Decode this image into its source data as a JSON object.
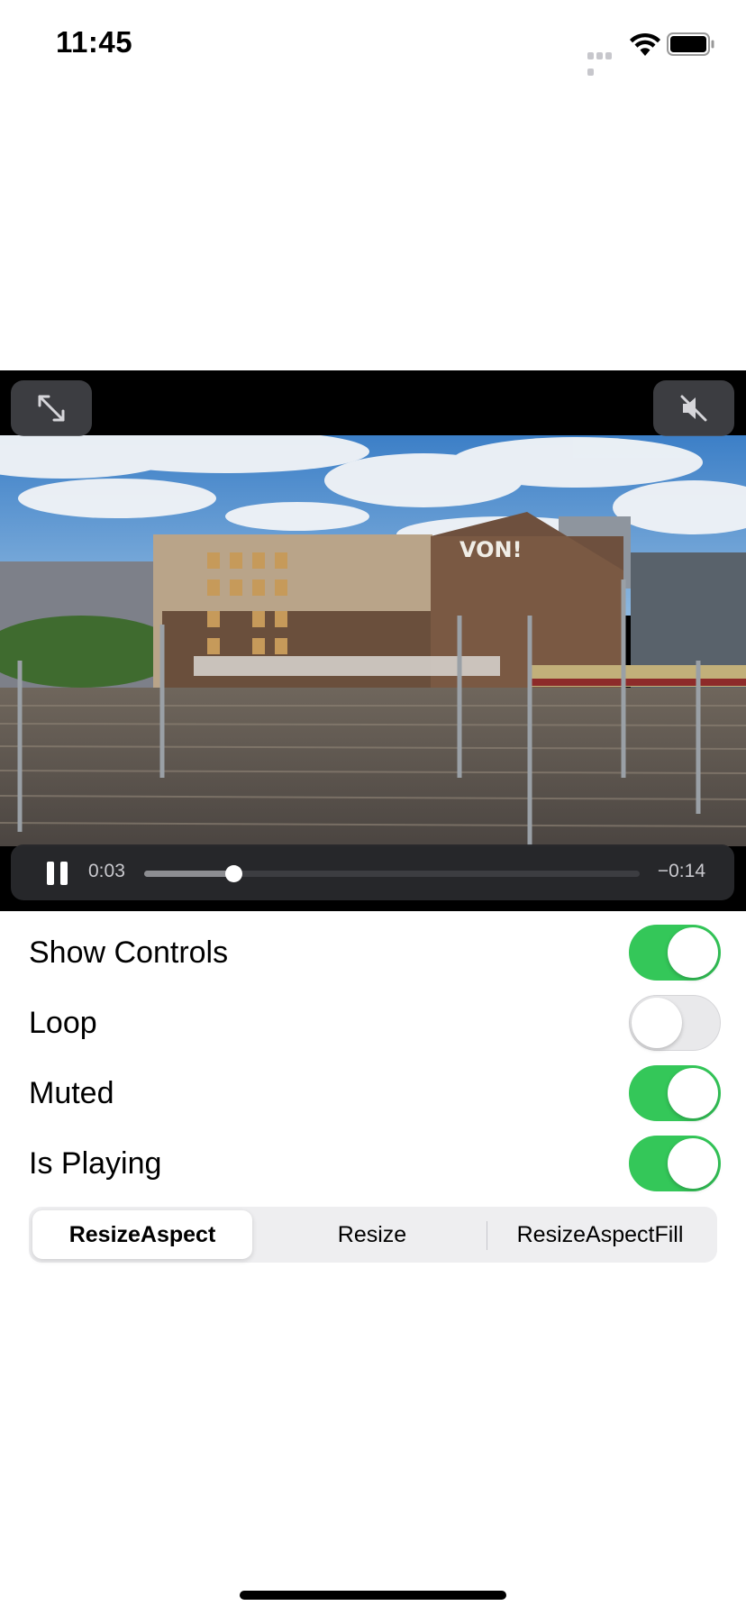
{
  "status_bar": {
    "time": "11:45",
    "icons": [
      "signal-icon",
      "wifi-icon",
      "battery-icon"
    ]
  },
  "player": {
    "fullscreen_icon": "expand-arrows-icon",
    "mute_icon": "speaker-muted-icon",
    "play_state_icon": "pause-icon",
    "elapsed": "0:03",
    "remaining": "−0:14",
    "progress": 0.18,
    "video_sign_text": "VON!"
  },
  "settings": {
    "rows": [
      {
        "label": "Show Controls",
        "on": true
      },
      {
        "label": "Loop",
        "on": false
      },
      {
        "label": "Muted",
        "on": true
      },
      {
        "label": "Is Playing",
        "on": true
      }
    ]
  },
  "segmented": {
    "options": [
      "ResizeAspect",
      "Resize",
      "ResizeAspectFill"
    ],
    "selected_index": 0
  },
  "colors": {
    "toggle_on": "#34c759",
    "toggle_off": "#e9e9eb",
    "player_bg": "#000000"
  }
}
